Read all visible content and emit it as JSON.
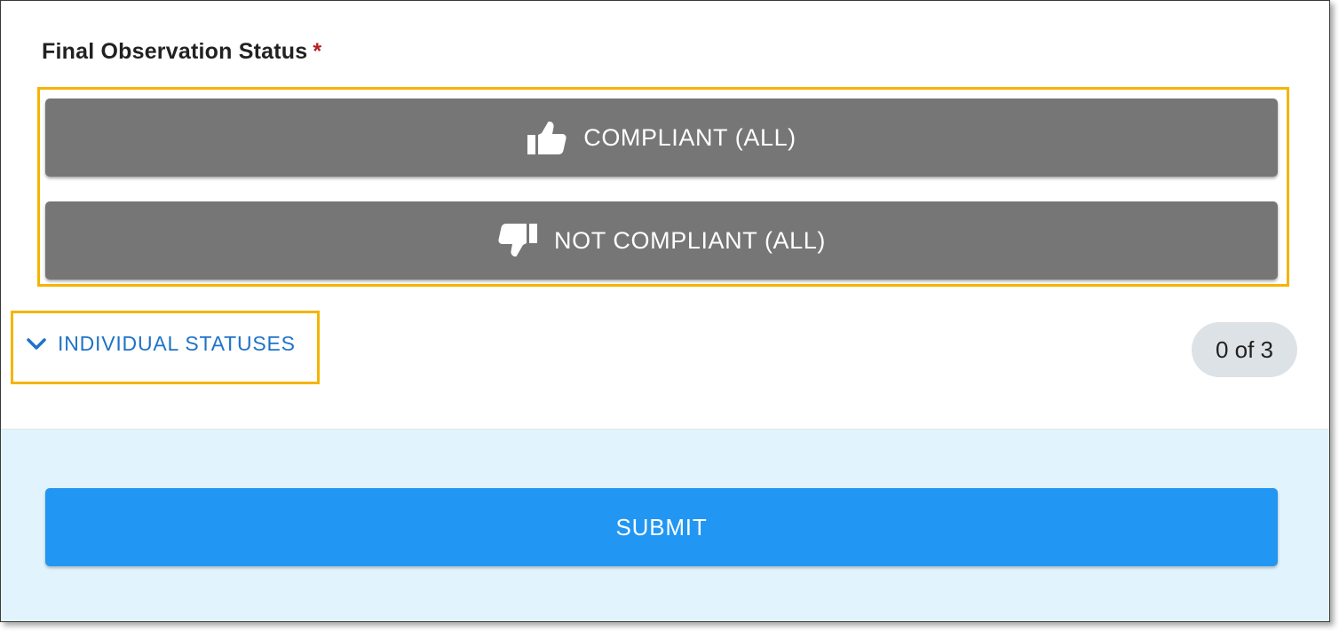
{
  "form": {
    "field_label": "Final Observation Status",
    "required_marker": "*"
  },
  "status_buttons": {
    "compliant": {
      "label": "COMPLIANT (ALL)",
      "icon": "thumbs-up-icon"
    },
    "not_compliant": {
      "label": "NOT COMPLIANT (ALL)",
      "icon": "thumbs-down-icon"
    }
  },
  "individual": {
    "toggle_label": "INDIVIDUAL STATUSES",
    "toggle_icon": "chevron-down-icon",
    "count_text": "0 of 3"
  },
  "footer": {
    "submit_label": "SUBMIT"
  },
  "colors": {
    "status_button_bg": "#767676",
    "submit_bg": "#2196f3",
    "footer_bg": "#e1f3fc",
    "link_blue": "#1e73c8",
    "highlight": "#f5b400",
    "required": "#b71c1c"
  }
}
